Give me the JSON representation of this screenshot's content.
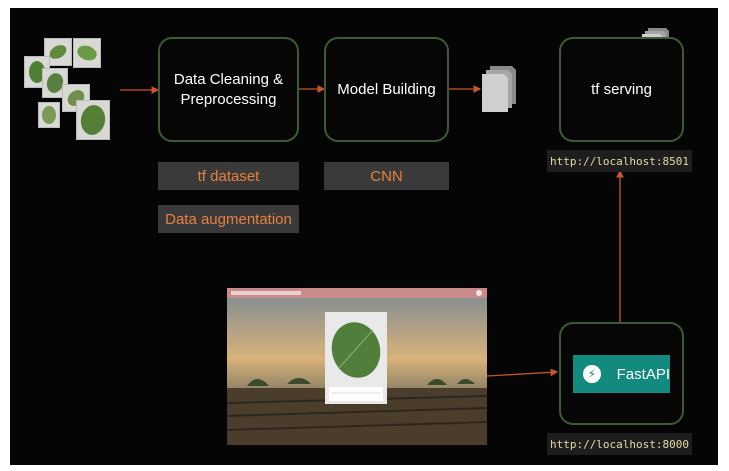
{
  "nodes": {
    "data_cleaning": "Data Cleaning &\nPreprocessing",
    "model_building": "Model Building",
    "tf_serving": "tf serving"
  },
  "tags": {
    "tf_dataset": "tf dataset",
    "data_augmentation": "Data augmentation",
    "cnn": "CNN"
  },
  "urls": {
    "tf_serving_url": "http://localhost:8501",
    "fastapi_url": "http://localhost:8000"
  },
  "fastapi": {
    "label": "FastAPI"
  },
  "colors": {
    "arrow": "#c8552e",
    "box_border": "#3d5a33",
    "tag_text": "#e8803f",
    "fastapi": "#128a7d"
  }
}
